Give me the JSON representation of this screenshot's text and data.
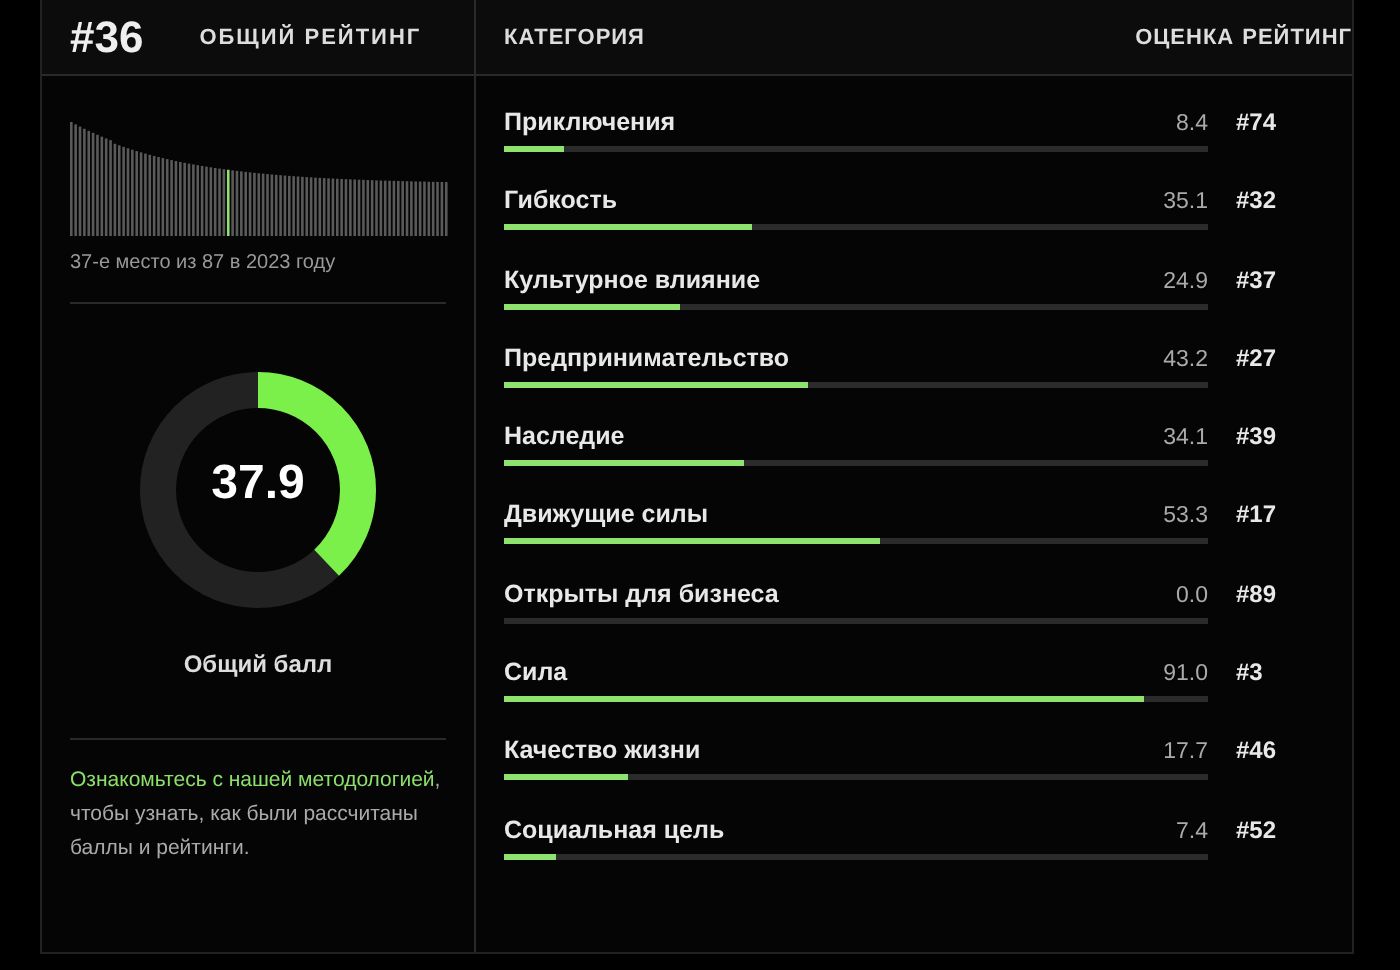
{
  "overall": {
    "rank": "#36",
    "title": "ОБЩИЙ РЕЙТИНГ",
    "caption": "37-е место из 87 в 2023 году",
    "score": "37.9",
    "level": 0.379,
    "score_label": "Общий балл",
    "link": "Ознакомьтесь с нашей методологией",
    "note": ", чтобы узнать, как были рассчитаны баллы и рейтинги."
  },
  "table": {
    "columns": [
      "КАТЕГОРИЯ",
      "ОЦЕНКА",
      "РЕЙТИНГ"
    ],
    "rows": [
      {
        "name": "Приключения",
        "score": "8.4",
        "level": 0.084,
        "rank": "#74"
      },
      {
        "name": "Гибкость",
        "score": "35.1",
        "level": 0.351,
        "rank": "#32"
      },
      {
        "name": "Культурное влияние",
        "score": "24.9",
        "level": 0.249,
        "rank": "#37"
      },
      {
        "name": "Предпринимательство",
        "score": "43.2",
        "level": 0.432,
        "rank": "#27"
      },
      {
        "name": "Наследие",
        "score": "34.1",
        "level": 0.341,
        "rank": "#39"
      },
      {
        "name": "Движущие силы",
        "score": "53.3",
        "level": 0.533,
        "rank": "#17"
      },
      {
        "name": "Открыты для бизнеса",
        "score": "0.0",
        "level": 0.0,
        "rank": "#89"
      },
      {
        "name": "Сила",
        "score": "91.0",
        "level": 0.91,
        "rank": "#3"
      },
      {
        "name": "Качество жизни",
        "score": "17.7",
        "level": 0.177,
        "rank": "#46"
      },
      {
        "name": "Социальная цель",
        "score": "7.4",
        "level": 0.074,
        "rank": "#52"
      }
    ]
  }
}
